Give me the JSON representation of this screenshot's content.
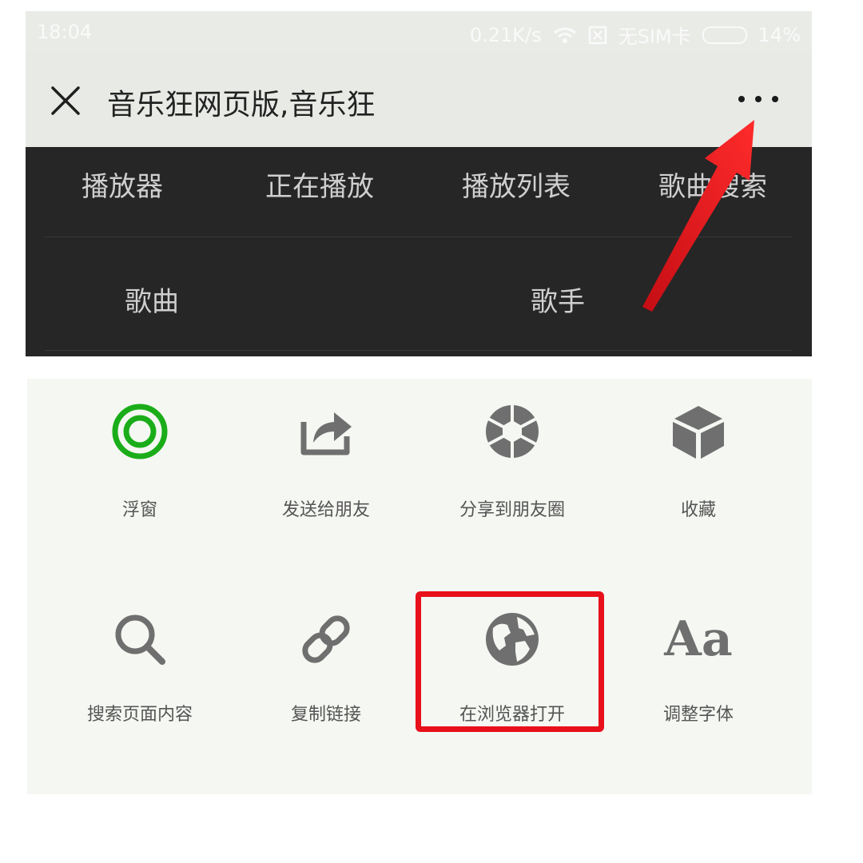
{
  "status_bar": {
    "time": "18:04",
    "net_speed": "0.21K/s",
    "sim": "无SIM卡",
    "battery": "14%"
  },
  "title_bar": {
    "title": "音乐狂网页版,音乐狂"
  },
  "web_menu": {
    "row1": [
      "播放器",
      "正在播放",
      "播放列表",
      "歌曲搜索"
    ],
    "row2": [
      "歌曲",
      "歌手"
    ]
  },
  "actions": [
    {
      "label": "浮窗",
      "icon": "float-window-icon",
      "color": "#1aad19"
    },
    {
      "label": "发送给朋友",
      "icon": "share-forward-icon",
      "color": "#6f6f6f"
    },
    {
      "label": "分享到朋友圈",
      "icon": "moments-shutter-icon",
      "color": "#6f6f6f"
    },
    {
      "label": "收藏",
      "icon": "favorite-cube-icon",
      "color": "#6f6f6f"
    },
    {
      "label": "搜索页面内容",
      "icon": "search-icon",
      "color": "#6f6f6f"
    },
    {
      "label": "复制链接",
      "icon": "link-icon",
      "color": "#6f6f6f"
    },
    {
      "label": "在浏览器打开",
      "icon": "globe-icon",
      "color": "#6f6f6f"
    },
    {
      "label": "调整字体",
      "icon": "font-size-icon",
      "glyph": "Aa",
      "color": "#6f6f6f"
    }
  ],
  "annotations": {
    "arrow_color": "#e8101a",
    "highlight_color": "#e8101a"
  }
}
